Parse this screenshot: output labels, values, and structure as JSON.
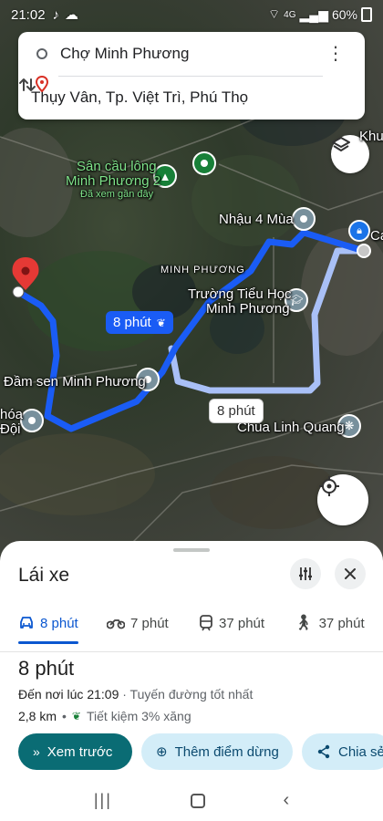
{
  "status_bar": {
    "time": "21:02",
    "network": "4G",
    "battery": "60%",
    "icons": [
      "tiktok-icon",
      "download-icon",
      "cloud-icon",
      "signal-icon",
      "battery-icon"
    ]
  },
  "search": {
    "origin": "Chợ Minh Phương",
    "destination": "Thụy Vân, Tp. Việt Trì, Phú Thọ",
    "more_icon": "more-vert-icon",
    "swap_icon": "swap-vert-icon"
  },
  "map": {
    "labels": {
      "san_cau_long_1": "Sân cầu lông",
      "san_cau_long_2": "Minh Phương 2",
      "da_xem": "Đã xem gần đây",
      "nhau": "Nhậu 4 Mùa",
      "minh_phuong": "MINH PHƯƠNG",
      "truong_1": "Trường Tiểu Học",
      "truong_2": "Minh Phương",
      "dam_sen": "Đầm sen Minh Phương",
      "chua": "Chùa Linh Quang",
      "khu": "Khu",
      "ca": "Ca",
      "hoa": "hóa",
      "doi": "Đội"
    },
    "route_primary_label": "8 phút",
    "route_alt_label": "8 phút",
    "colors": {
      "route": "#1a5cf5",
      "route_alt": "#a9c0f7",
      "accent": "#0a6c74"
    }
  },
  "sheet": {
    "title": "Lái xe",
    "modes": [
      {
        "label": "8 phút",
        "icon": "car-icon"
      },
      {
        "label": "7 phút",
        "icon": "motorbike-icon"
      },
      {
        "label": "37 phút",
        "icon": "transit-icon"
      },
      {
        "label": "37 phút",
        "icon": "walk-icon"
      }
    ],
    "duration": "8 phút",
    "arrival": "Đến nơi lúc 21:09",
    "route_note": "· Tuyến đường tốt nhất",
    "distance": "2,8 km",
    "bullet": "•",
    "fuel": "Tiết kiệm 3% xăng",
    "actions": {
      "preview": "Xem trước",
      "add_stop": "Thêm điểm dừng",
      "share": "Chia sẻ"
    }
  }
}
